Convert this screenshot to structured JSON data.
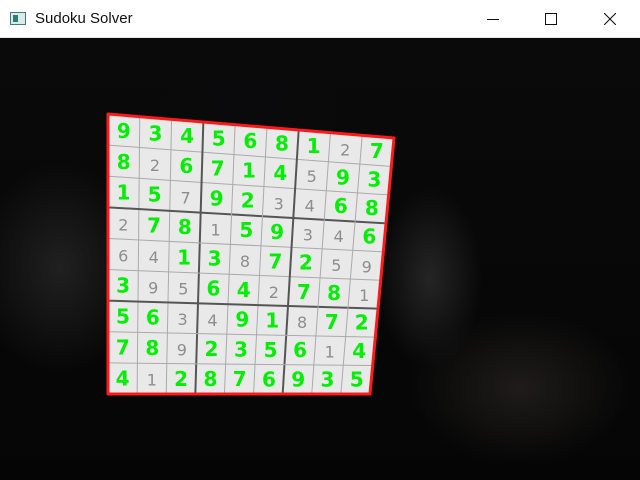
{
  "window": {
    "title": "Sudoku Solver",
    "icon": "app-window-icon",
    "controls": [
      "minimize",
      "maximize",
      "close"
    ]
  },
  "board": {
    "colors": {
      "given": "#8d8d8d",
      "solved": "#00ee00",
      "outline": "#ff1a1a"
    },
    "cells": [
      [
        {
          "v": "9",
          "s": 1
        },
        {
          "v": "3",
          "s": 1
        },
        {
          "v": "4",
          "s": 1
        },
        {
          "v": "5",
          "s": 1
        },
        {
          "v": "6",
          "s": 1
        },
        {
          "v": "8",
          "s": 1
        },
        {
          "v": "1",
          "s": 1
        },
        {
          "v": "2",
          "s": 0
        },
        {
          "v": "7",
          "s": 1
        }
      ],
      [
        {
          "v": "8",
          "s": 1
        },
        {
          "v": "2",
          "s": 0
        },
        {
          "v": "6",
          "s": 1
        },
        {
          "v": "7",
          "s": 1
        },
        {
          "v": "1",
          "s": 1
        },
        {
          "v": "4",
          "s": 1
        },
        {
          "v": "5",
          "s": 0
        },
        {
          "v": "9",
          "s": 1
        },
        {
          "v": "3",
          "s": 1
        }
      ],
      [
        {
          "v": "1",
          "s": 1
        },
        {
          "v": "5",
          "s": 1
        },
        {
          "v": "7",
          "s": 0
        },
        {
          "v": "9",
          "s": 1
        },
        {
          "v": "2",
          "s": 1
        },
        {
          "v": "3",
          "s": 0
        },
        {
          "v": "4",
          "s": 0
        },
        {
          "v": "6",
          "s": 1
        },
        {
          "v": "8",
          "s": 1
        }
      ],
      [
        {
          "v": "2",
          "s": 0
        },
        {
          "v": "7",
          "s": 1
        },
        {
          "v": "8",
          "s": 1
        },
        {
          "v": "1",
          "s": 0
        },
        {
          "v": "5",
          "s": 1
        },
        {
          "v": "9",
          "s": 1
        },
        {
          "v": "3",
          "s": 0
        },
        {
          "v": "4",
          "s": 0
        },
        {
          "v": "6",
          "s": 1
        }
      ],
      [
        {
          "v": "6",
          "s": 0
        },
        {
          "v": "4",
          "s": 0
        },
        {
          "v": "1",
          "s": 1
        },
        {
          "v": "3",
          "s": 1
        },
        {
          "v": "8",
          "s": 0
        },
        {
          "v": "7",
          "s": 1
        },
        {
          "v": "2",
          "s": 1
        },
        {
          "v": "5",
          "s": 0
        },
        {
          "v": "9",
          "s": 0
        }
      ],
      [
        {
          "v": "3",
          "s": 1
        },
        {
          "v": "9",
          "s": 0
        },
        {
          "v": "5",
          "s": 0
        },
        {
          "v": "6",
          "s": 1
        },
        {
          "v": "4",
          "s": 1
        },
        {
          "v": "2",
          "s": 0
        },
        {
          "v": "7",
          "s": 1
        },
        {
          "v": "8",
          "s": 1
        },
        {
          "v": "1",
          "s": 0
        }
      ],
      [
        {
          "v": "5",
          "s": 1
        },
        {
          "v": "6",
          "s": 1
        },
        {
          "v": "3",
          "s": 0
        },
        {
          "v": "4",
          "s": 0
        },
        {
          "v": "9",
          "s": 1
        },
        {
          "v": "1",
          "s": 1
        },
        {
          "v": "8",
          "s": 0
        },
        {
          "v": "7",
          "s": 1
        },
        {
          "v": "2",
          "s": 1
        }
      ],
      [
        {
          "v": "7",
          "s": 1
        },
        {
          "v": "8",
          "s": 1
        },
        {
          "v": "9",
          "s": 0
        },
        {
          "v": "2",
          "s": 1
        },
        {
          "v": "3",
          "s": 1
        },
        {
          "v": "5",
          "s": 1
        },
        {
          "v": "6",
          "s": 1
        },
        {
          "v": "1",
          "s": 0
        },
        {
          "v": "4",
          "s": 1
        }
      ],
      [
        {
          "v": "4",
          "s": 1
        },
        {
          "v": "1",
          "s": 0
        },
        {
          "v": "2",
          "s": 1
        },
        {
          "v": "8",
          "s": 1
        },
        {
          "v": "7",
          "s": 1
        },
        {
          "v": "6",
          "s": 1
        },
        {
          "v": "9",
          "s": 1
        },
        {
          "v": "3",
          "s": 1
        },
        {
          "v": "5",
          "s": 1
        }
      ]
    ]
  }
}
